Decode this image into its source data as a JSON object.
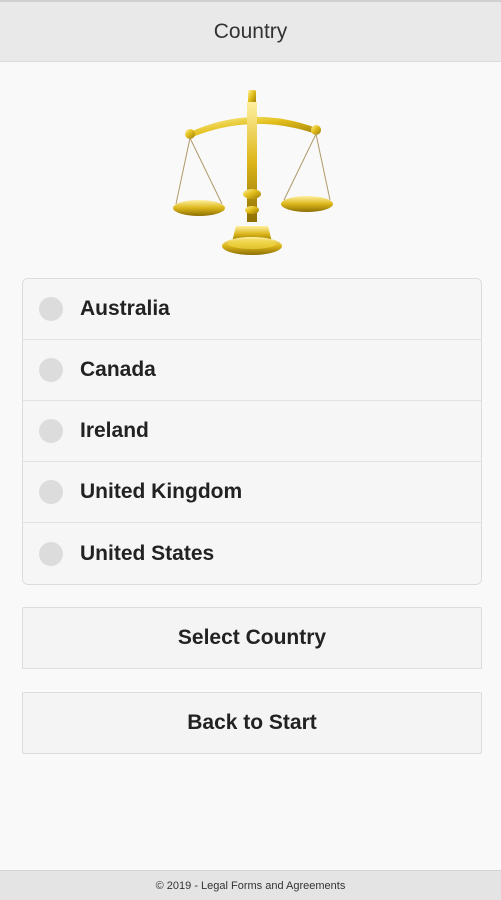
{
  "header": {
    "title": "Country"
  },
  "countries": [
    {
      "label": "Australia"
    },
    {
      "label": "Canada"
    },
    {
      "label": "Ireland"
    },
    {
      "label": "United Kingdom"
    },
    {
      "label": "United States"
    }
  ],
  "buttons": {
    "select_label": "Select Country",
    "back_label": "Back to Start"
  },
  "footer": {
    "text": "© 2019 - Legal Forms and Agreements"
  },
  "colors": {
    "header_bg": "#e9e9e9",
    "page_bg": "#f9f9f9",
    "radio_dot": "#dcdcdc",
    "scale_gold": "#d4b11a"
  },
  "icons": {
    "logo": "scales-of-justice-icon"
  }
}
